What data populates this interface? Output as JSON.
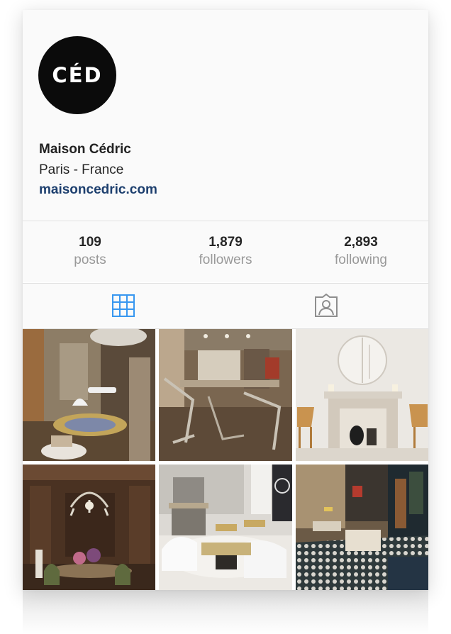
{
  "profile": {
    "avatar_text": "CÉD",
    "name": "Maison Cédric",
    "location": "Paris - France",
    "website": "maisoncedric.com"
  },
  "stats": [
    {
      "value": "109",
      "label": "posts"
    },
    {
      "value": "1,879",
      "label": "followers"
    },
    {
      "value": "2,893",
      "label": "following"
    }
  ],
  "tabs": [
    {
      "icon": "grid-icon",
      "active": true
    },
    {
      "icon": "tagged-icon",
      "active": false
    }
  ],
  "colors": {
    "link": "#1d3f6e",
    "active_tab": "#3897f0",
    "inactive_tab": "#8e8e8e",
    "muted_label": "#999999"
  },
  "posts": [
    {
      "icon": "interior-photo-1"
    },
    {
      "icon": "interior-photo-2"
    },
    {
      "icon": "interior-photo-3"
    },
    {
      "icon": "interior-photo-4"
    },
    {
      "icon": "interior-photo-5"
    },
    {
      "icon": "interior-photo-6"
    }
  ]
}
